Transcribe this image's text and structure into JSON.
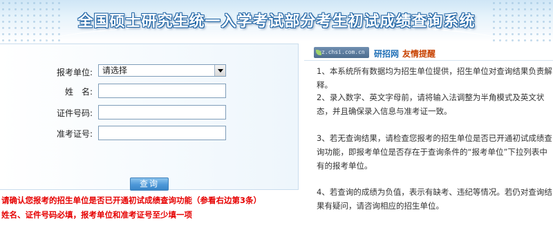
{
  "banner": {
    "title": "全国硕士研究生统一入学考试部分考生初试成绩查询系统"
  },
  "form": {
    "unit_label": "报考单位:",
    "unit_selected": "请选择",
    "name_label": "姓　名:",
    "id_label": "证件号码:",
    "ticket_label": "准考证号:",
    "submit_label": "查询"
  },
  "warnings": [
    "请确认您报考的招生单位是否已开通初试成绩查询功能（参看右边第3条）",
    "姓名、证件号码必填，报考单位和准考证号至少填一项"
  ],
  "sidebar": {
    "site_badge": "yz.chsi.com.cn",
    "brand": "研招网",
    "tip": "友情提醒",
    "notices": [
      "1、本系统所有数据均为招生单位提供，招生单位对查询结果负责解释。",
      "2、录入数字、英文字母前，请将输入法调整为半角模式及英文状态，并且确保录入信息与准考证一致。",
      "3、若无查询结果，请检查您报考的招生单位是否已开通初试成绩查询功能，即报考单位是否存在于查询条件的“报考单位”下拉列表中有的报考单位。",
      "4、若查询的成绩为负值，表示有缺考、违纪等情况。若仍对查询结果有疑问，请咨询相应的招生单位。"
    ]
  },
  "colors": {
    "title_stroke": "#1d63a5",
    "warning": "#e60000",
    "brand": "#1f6fb6",
    "tip": "#c84200",
    "button": "#4d98d8"
  }
}
